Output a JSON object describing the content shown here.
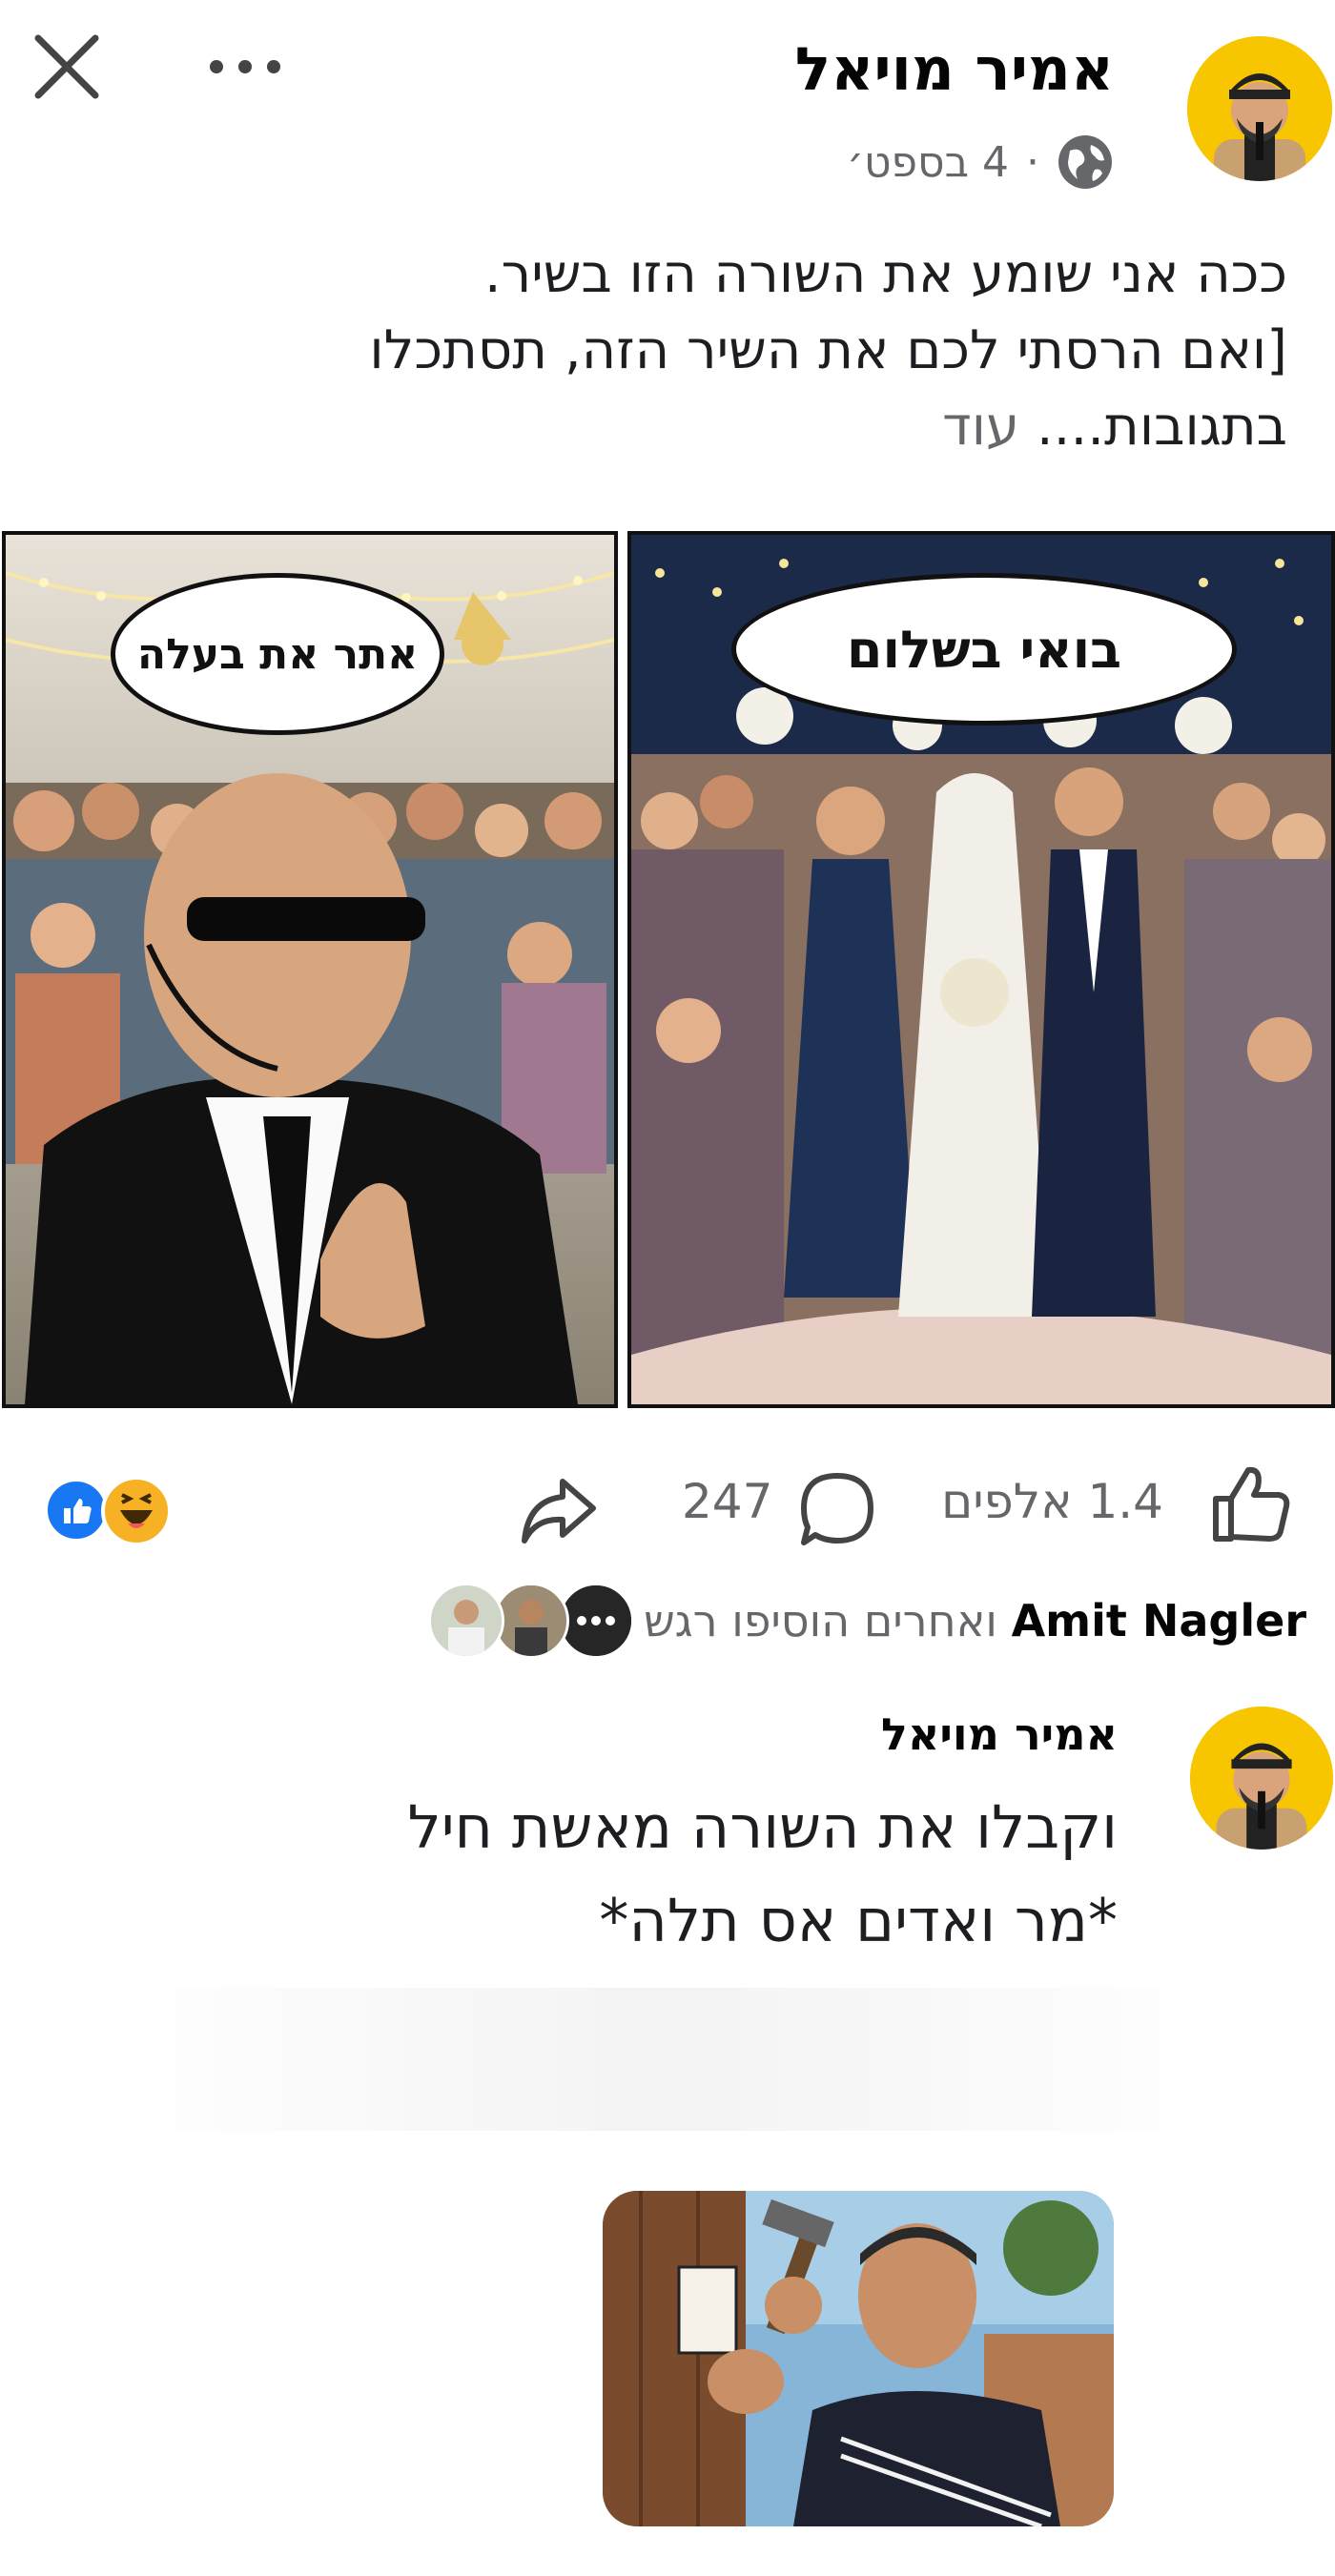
{
  "header": {
    "author": "אמיר מויאל",
    "date": "4 בספט׳",
    "separator": "·",
    "close_icon": "close-icon",
    "more_icon": "more-horizontal-icon",
    "privacy_icon": "globe-icon"
  },
  "post": {
    "line1": "ככה אני שומע את השורה הזו בשיר.",
    "line2": "[ואם הרסתי לכם את השיר הזה, תסתכלו",
    "line3": "בתגובות....",
    "more": "עוד"
  },
  "comic": {
    "left_bubble": "אתר את בעלה",
    "right_bubble": "בואי בשלום"
  },
  "stats": {
    "likes": "1.4 אלפים",
    "comments": "247",
    "reaction_icons": [
      "like-icon",
      "haha-icon"
    ]
  },
  "reactors": {
    "name": "Amit Nagler",
    "rest": "ואחרים הוסיפו רגש"
  },
  "comment": {
    "author": "אמיר מויאל",
    "line1": "וקבלו את השורה מאשת חיל",
    "line2": "*מר ואדים אס תלה*"
  },
  "colors": {
    "brand_blue": "#1877f2",
    "secondary_text": "#65676b",
    "avatar_yellow": "#f7c600"
  }
}
